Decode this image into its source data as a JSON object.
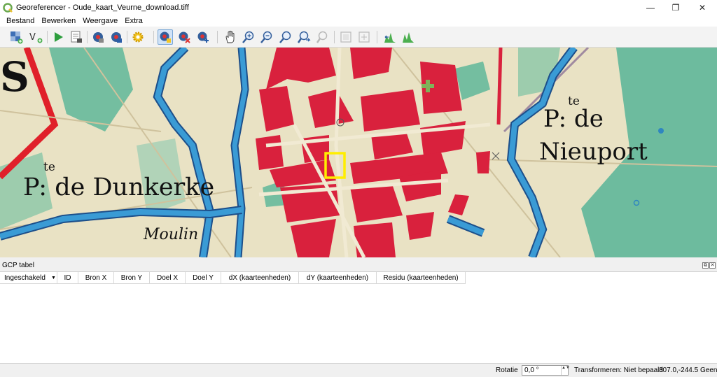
{
  "window": {
    "title": "Georeferencer - Oude_kaart_Veurne_download.tiff",
    "minimize": "—",
    "restore": "❐",
    "close": "✕"
  },
  "menu": [
    "Bestand",
    "Bewerken",
    "Weergave",
    "Extra"
  ],
  "toolbar": {
    "icons": [
      "open-raster-icon",
      "start-georeferencing-icon",
      "generate-gdal-script-icon",
      "load-gcp-points-icon",
      "save-gcp-points-icon",
      "transformation-settings-icon",
      "add-point-icon",
      "delete-point-icon",
      "move-point-icon",
      "pan-icon",
      "zoom-in-icon",
      "zoom-out-icon",
      "zoom-to-layer-icon",
      "zoom-last-icon",
      "zoom-next-icon",
      "link-georef-to-qgis-icon",
      "link-qgis-to-georef-icon",
      "local-histogram-stretch-icon",
      "full-histogram-stretch-icon"
    ],
    "active_tool": "add-point-icon"
  },
  "map": {
    "labels": {
      "te_left": "te",
      "dunkerke": "P: de Dunkerke",
      "moulin": "Moulin",
      "te_right": "te",
      "nieuport1": "P: de",
      "nieuport2": "Nieuport",
      "s": "S"
    },
    "colors": {
      "paper": "#e9e2c4",
      "water": "#2f86c0",
      "green": "#5fb79a",
      "buildings": "#d9213d",
      "highlight": "#ffee00"
    }
  },
  "gcp": {
    "title": "GCP tabel",
    "float_btn": "⧉",
    "close_btn": "✕",
    "columns": [
      "Ingeschakeld",
      "ID",
      "Bron X",
      "Bron Y",
      "Doel X",
      "Doel Y",
      "dX (kaarteenheden)",
      "dY (kaarteenheden)",
      "Residu (kaarteenheden)"
    ],
    "sort_arrow": "▼"
  },
  "status": {
    "rotation_label": "Rotatie",
    "rotation_value": "0,0 °",
    "spin_arrows": "▲▼",
    "transform": "Transformeren: Niet bepaald",
    "coords": "307.0,-244.5",
    "crs": "Geen"
  }
}
